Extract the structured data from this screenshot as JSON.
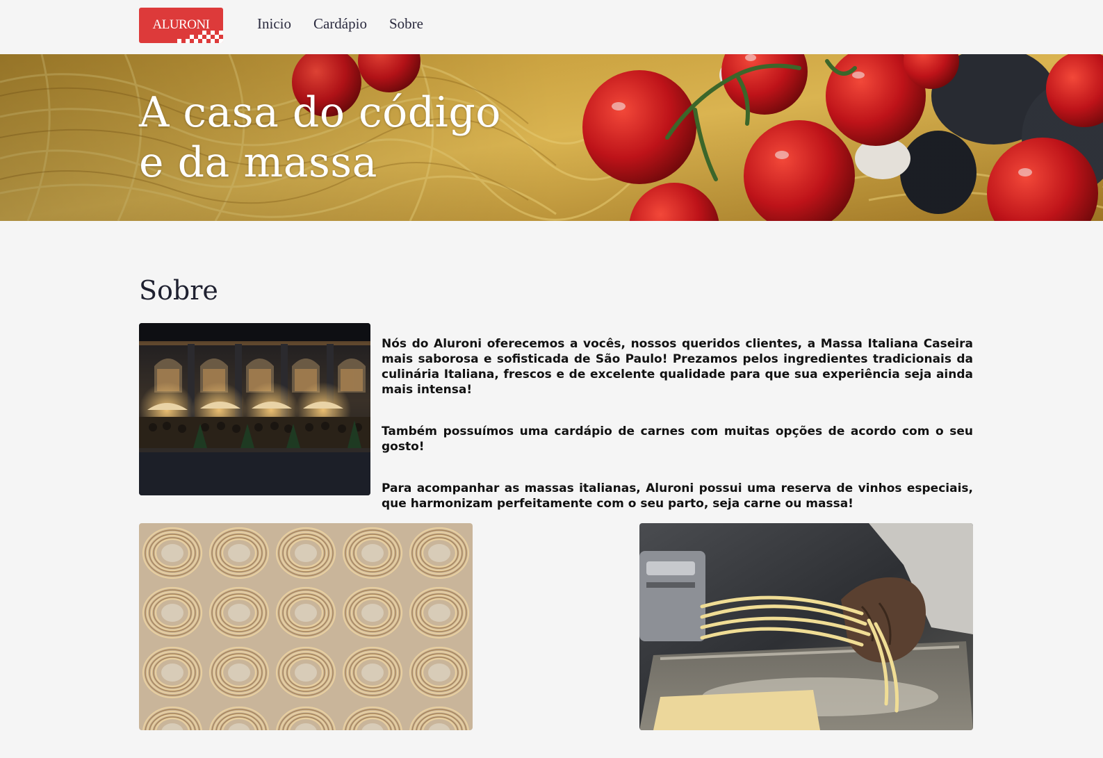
{
  "header": {
    "logo_text": "ALURONI",
    "nav": [
      {
        "label": "Inicio"
      },
      {
        "label": "Cardápio"
      },
      {
        "label": "Sobre"
      }
    ]
  },
  "hero": {
    "title_line1": "A casa do código",
    "title_line2": "e da massa"
  },
  "about": {
    "title": "Sobre",
    "paragraphs": [
      "Nós do Aluroni oferecemos a vocês, nossos queridos clientes, a Massa Italiana Caseira mais saborosa e sofisticada de São Paulo! Prezamos pelos ingredientes tradicionais da culinária Italiana, frescos e de excelente qualidade para que sua experiência seja ainda mais intensa!",
      "Também possuímos uma cardápio de carnes com muitas opções de acordo com o seu gosto!",
      "Para acompanhar as massas italianas, Aluroni possui uma reserva de vinhos especiais, que harmonizam perfeitamente com o seu parto, seja carne ou massa!"
    ]
  },
  "colors": {
    "brand_red": "#dd3a3a",
    "page_bg": "#f5f5f5",
    "nav_text": "#2a2a3e"
  },
  "icons": {
    "logo_pattern": "checkered-flag"
  }
}
